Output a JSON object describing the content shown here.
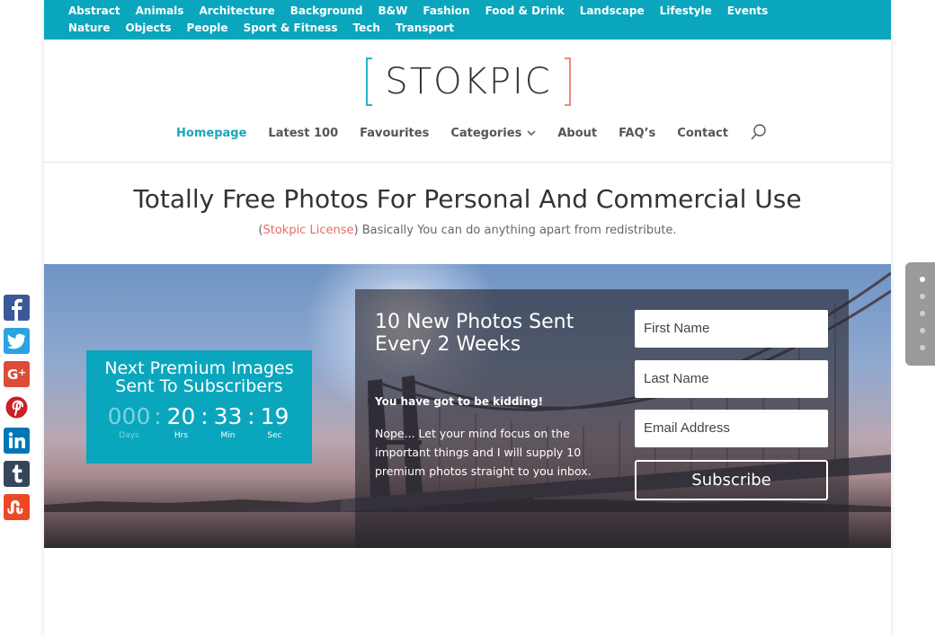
{
  "topbar": {
    "categories": [
      "Abstract",
      "Animals",
      "Architecture",
      "Background",
      "B&W",
      "Fashion",
      "Food & Drink",
      "Landscape",
      "Lifestyle",
      "Events",
      "Nature",
      "Objects",
      "People",
      "Sport & Fitness",
      "Tech",
      "Transport"
    ]
  },
  "logo": {
    "text": "STOKPIC"
  },
  "nav": {
    "items": [
      "Homepage",
      "Latest 100",
      "Favourites",
      "Categories",
      "About",
      "FAQ’s",
      "Contact"
    ],
    "active": "Homepage"
  },
  "headline": "Totally Free Photos For Personal And Commercial Use",
  "subline": {
    "open": "(",
    "license_link": "Stokpic License",
    "rest": ") Basically You can do anything apart from redistribute."
  },
  "countdown": {
    "title": "Next Premium Images Sent To Subscribers",
    "days": "000",
    "hours": "20",
    "minutes": "33",
    "seconds": "19",
    "label_days": "Days",
    "label_hours": "Hrs",
    "label_minutes": "Min",
    "label_seconds": "Sec",
    "sep": ":"
  },
  "subscribe": {
    "title": "10 New Photos Sent Every 2 Weeks",
    "kidding": "You have got to be kidding!",
    "description": "Nope... Let your mind focus on the important things and I will supply 10 premium photos straight to you inbox.",
    "first_name_placeholder": "First Name",
    "last_name_placeholder": "Last Name",
    "email_placeholder": "Email Address",
    "button": "Subscribe"
  },
  "social": [
    "facebook-icon",
    "twitter-icon",
    "google-plus-icon",
    "pinterest-icon",
    "linkedin-icon",
    "tumblr-icon",
    "stumbleupon-icon"
  ],
  "colors": {
    "accent": "#0aa6bd",
    "link": "#ec6c5f",
    "logo_left": "#27b3c7",
    "logo_right": "#ec8a80"
  },
  "slider_dots": {
    "count": 5,
    "active_index": 0
  }
}
